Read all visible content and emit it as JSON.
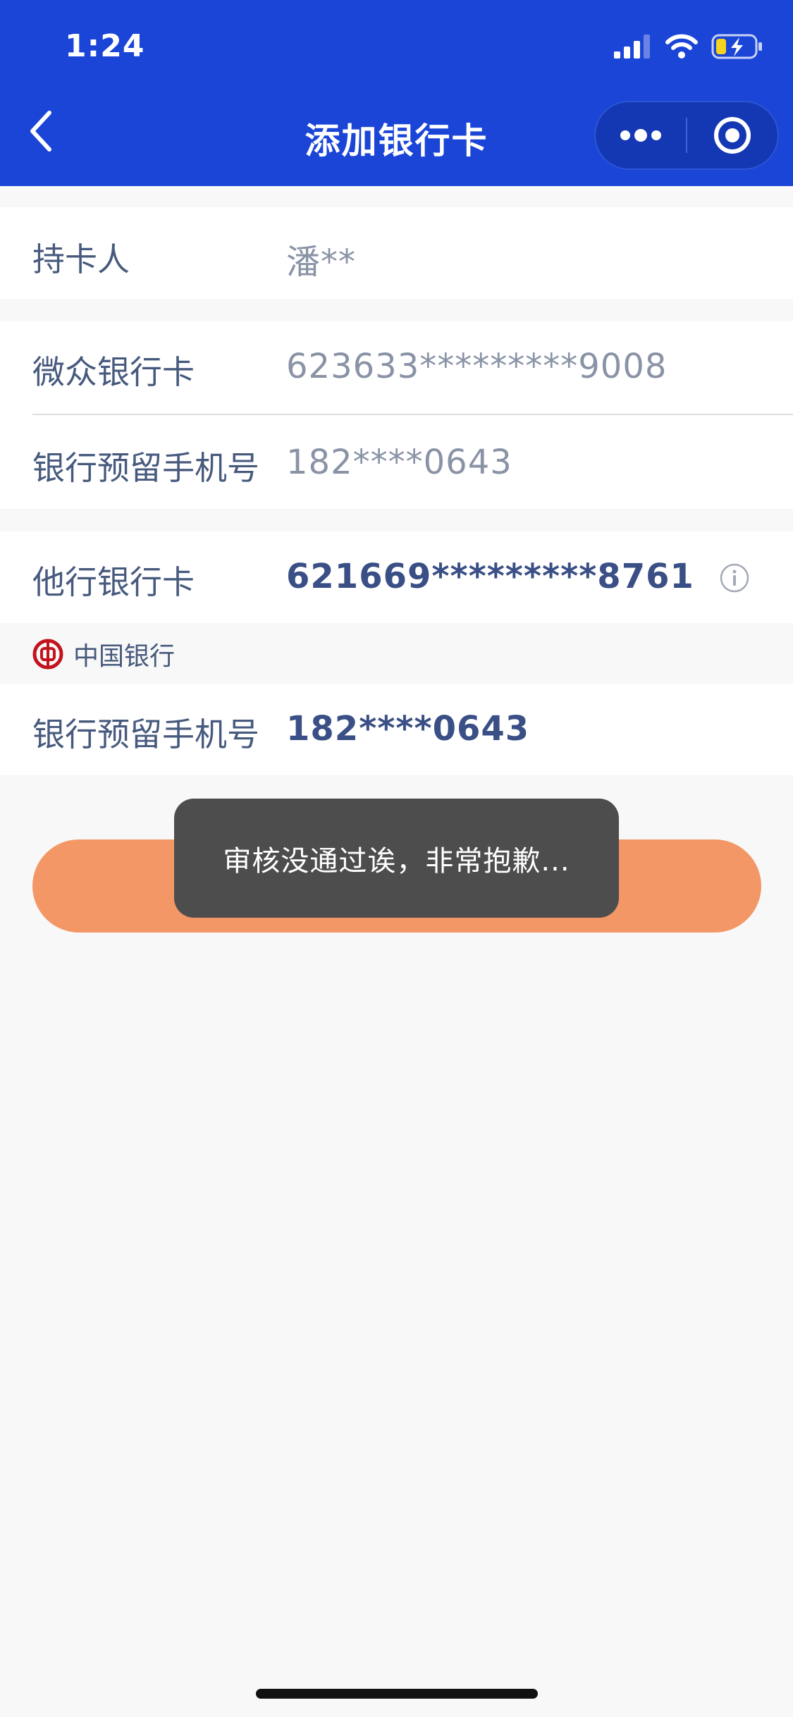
{
  "status_bar": {
    "time": "1:24"
  },
  "nav": {
    "title": "添加银行卡"
  },
  "card_holder": {
    "label": "持卡人",
    "value": "潘**"
  },
  "webank": {
    "card_label": "微众银行卡",
    "card_value": "623633*********9008",
    "phone_label": "银行预留手机号",
    "phone_value": "182****0643"
  },
  "other_bank": {
    "card_label": "他行银行卡",
    "card_value": "621669*********8761",
    "bank_name": "中国银行",
    "phone_label": "银行预留手机号",
    "phone_value": "182****0643"
  },
  "toast": {
    "message": "审核没通过诶，非常抱歉..."
  },
  "colors": {
    "header": "#1a45d6",
    "button": "#f39766",
    "toast": "#4d4d4d"
  },
  "icons": [
    "signal-icon",
    "wifi-icon",
    "battery-charging-icon",
    "back-chevron-icon",
    "more-dots-icon",
    "close-target-icon",
    "info-icon",
    "bank-of-china-logo"
  ]
}
